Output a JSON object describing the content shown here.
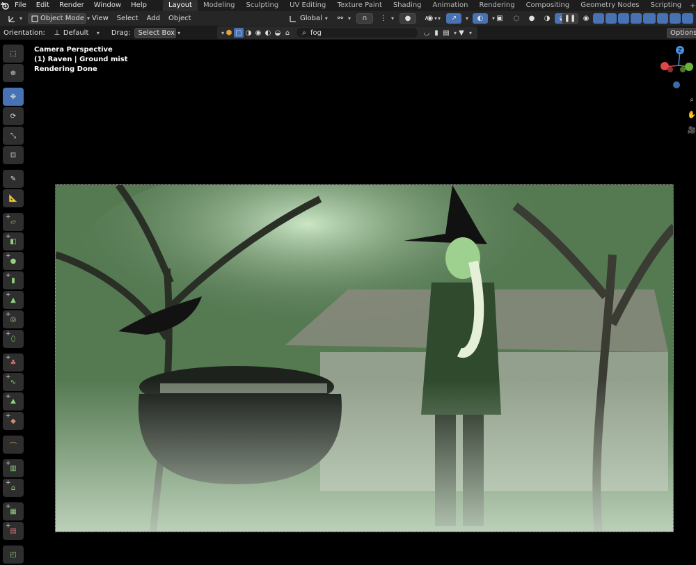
{
  "topbar": {
    "menus": [
      "File",
      "Edit",
      "Render",
      "Window",
      "Help"
    ],
    "workspaces": [
      {
        "label": "Layout",
        "active": true
      },
      {
        "label": "Modeling",
        "active": false
      },
      {
        "label": "Sculpting",
        "active": false
      },
      {
        "label": "UV Editing",
        "active": false
      },
      {
        "label": "Texture Paint",
        "active": false
      },
      {
        "label": "Shading",
        "active": false
      },
      {
        "label": "Animation",
        "active": false
      },
      {
        "label": "Rendering",
        "active": false
      },
      {
        "label": "Compositing",
        "active": false
      },
      {
        "label": "Geometry Nodes",
        "active": false
      },
      {
        "label": "Scripting",
        "active": false
      }
    ],
    "add_workspace": "+"
  },
  "header": {
    "mode": "Object Mode",
    "view": "View",
    "select": "Select",
    "add": "Add",
    "object": "Object",
    "transform_orientation": "Global"
  },
  "toolheader": {
    "orientation_label": "Orientation:",
    "orientation_value": "Default",
    "drag_label": "Drag:",
    "drag_value": "Select Box",
    "search_value": "fog",
    "options": "Options"
  },
  "overlay": {
    "line1": "Camera Perspective",
    "line2": "(1) Raven | Ground mist",
    "line3": "Rendering Done"
  },
  "gizmo": {
    "z_label": "Z"
  },
  "colors": {
    "accent": "#4772b3",
    "x_axis": "#e04646",
    "y_axis": "#6ab13b",
    "z_axis": "#4a8fe0"
  }
}
